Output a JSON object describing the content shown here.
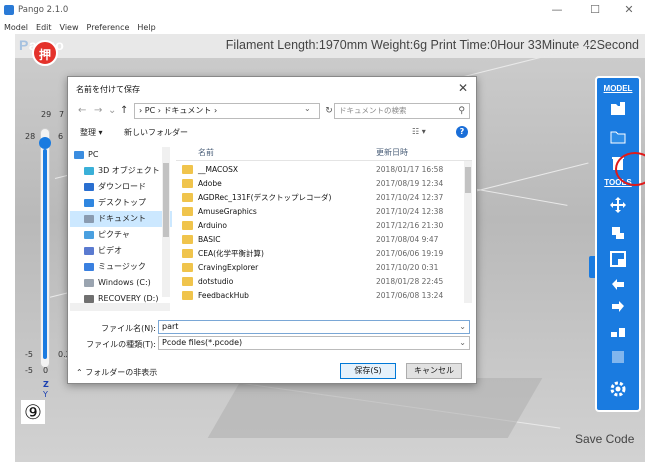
{
  "window": {
    "title": "Pango 2.1.0",
    "controls": {
      "minimize": "—",
      "maximize": "☐",
      "close": "✕"
    }
  },
  "menu": [
    "Model",
    "Edit",
    "View",
    "Preference",
    "Help"
  ],
  "app": {
    "logo_p": "P",
    "logo_rest": "ango",
    "stats": "Filament Length:1970mm  Weight:6g  Print Time:0Hour 33Minute 42Second",
    "push_button": "押",
    "slider_ticks": {
      "top": "29",
      "top2": "7",
      "left": "28",
      "left2": "6",
      "bottom": "-5",
      "bottom2": "0.2",
      "axis1": "-5",
      "axis2": "0",
      "z": "Z",
      "z2": "Y"
    },
    "step_marker": "⑨",
    "save_code": "Save Code"
  },
  "toolbar": {
    "model_label": "MODEL",
    "tools_label": "TOOLS"
  },
  "dialog": {
    "title": "名前を付けて保存",
    "close": "✕",
    "breadcrumb": "›  PC  ›  ドキュメント  ›",
    "search_placeholder": "ドキュメントの検索",
    "organize": "整理 ▾",
    "new_folder": "新しいフォルダー",
    "view_toggle": "☷ ▾",
    "help": "?",
    "nav_items": [
      {
        "label": "PC",
        "color": "#3b8de0"
      },
      {
        "label": "3D オブジェクト",
        "color": "#3ab0d8"
      },
      {
        "label": "ダウンロード",
        "color": "#2a6fd0"
      },
      {
        "label": "デスクトップ",
        "color": "#2f86e0"
      },
      {
        "label": "ドキュメント",
        "color": "#8a9bb0"
      },
      {
        "label": "ピクチャ",
        "color": "#4aa0e0"
      },
      {
        "label": "ビデオ",
        "color": "#5a7ad0"
      },
      {
        "label": "ミュージック",
        "color": "#3a80e0"
      },
      {
        "label": "Windows (C:)",
        "color": "#9aa4b0"
      },
      {
        "label": "RECOVERY (D:)",
        "color": "#707070"
      }
    ],
    "columns": {
      "name": "名前",
      "date": "更新日時"
    },
    "files": [
      {
        "name": "__MACOSX",
        "date": "2018/01/17 16:58"
      },
      {
        "name": "Adobe",
        "date": "2017/08/19 12:34"
      },
      {
        "name": "AGDRec_131F(デスクトップレコーダ)",
        "date": "2017/10/24 12:37"
      },
      {
        "name": "AmuseGraphics",
        "date": "2017/10/24 12:38"
      },
      {
        "name": "Arduino",
        "date": "2017/12/16 21:30"
      },
      {
        "name": "BASIC",
        "date": "2017/08/04 9:47"
      },
      {
        "name": "CEA(化学平衡計算)",
        "date": "2017/06/06 19:19"
      },
      {
        "name": "CravingExplorer",
        "date": "2017/10/20 0:31"
      },
      {
        "name": "dotstudio",
        "date": "2018/01/28 22:45"
      },
      {
        "name": "FeedbackHub",
        "date": "2017/06/08 13:24"
      }
    ],
    "filename_label": "ファイル名(N):",
    "filename_value": "part",
    "filetype_label": "ファイルの種類(T):",
    "filetype_value": "Pcode files(*.pcode)",
    "hide_folders": "フォルダーの非表示",
    "save": "保存(S)",
    "cancel": "キャンセル"
  }
}
